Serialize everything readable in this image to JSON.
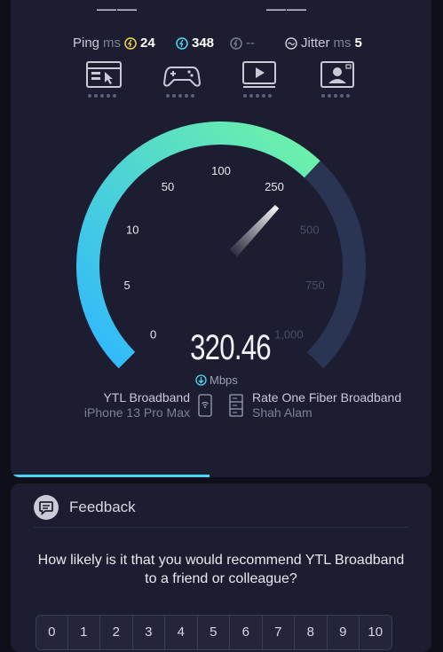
{
  "header": {
    "left_dash": "——",
    "right_dash": "——"
  },
  "stats": {
    "ping_label": "Ping",
    "ping_unit": "ms",
    "idle_value": "24",
    "download_value": "348",
    "upload_value": "--",
    "jitter_label": "Jitter",
    "jitter_unit": "ms",
    "jitter_value": "5",
    "colors": {
      "idle": "#f5d547",
      "download": "#4fd8f0",
      "upload": "#7e8095",
      "jitter": "#c9cad6"
    }
  },
  "test_icons": [
    "browse-icon",
    "gaming-icon",
    "video-icon",
    "video-call-icon"
  ],
  "gauge": {
    "ticks": [
      "0",
      "5",
      "10",
      "50",
      "100",
      "250",
      "500",
      "750",
      "1,000"
    ],
    "needle_value": 320.46,
    "colors": {
      "start": "#2fb7ff",
      "end": "#6ff3a6",
      "track": "#2a3553"
    }
  },
  "result": {
    "speed": "320.46",
    "unit": "Mbps"
  },
  "provider": {
    "isp_name": "YTL Broadband",
    "device": "iPhone 13 Pro Max",
    "server_name": "Rate One Fiber Broadband",
    "server_location": "Shah Alam"
  },
  "feedback": {
    "title": "Feedback",
    "question": "How likely is it that you would recommend YTL Broadband to a friend or colleague?",
    "scale": [
      "0",
      "1",
      "2",
      "3",
      "4",
      "5",
      "6",
      "7",
      "8",
      "9",
      "10"
    ]
  }
}
